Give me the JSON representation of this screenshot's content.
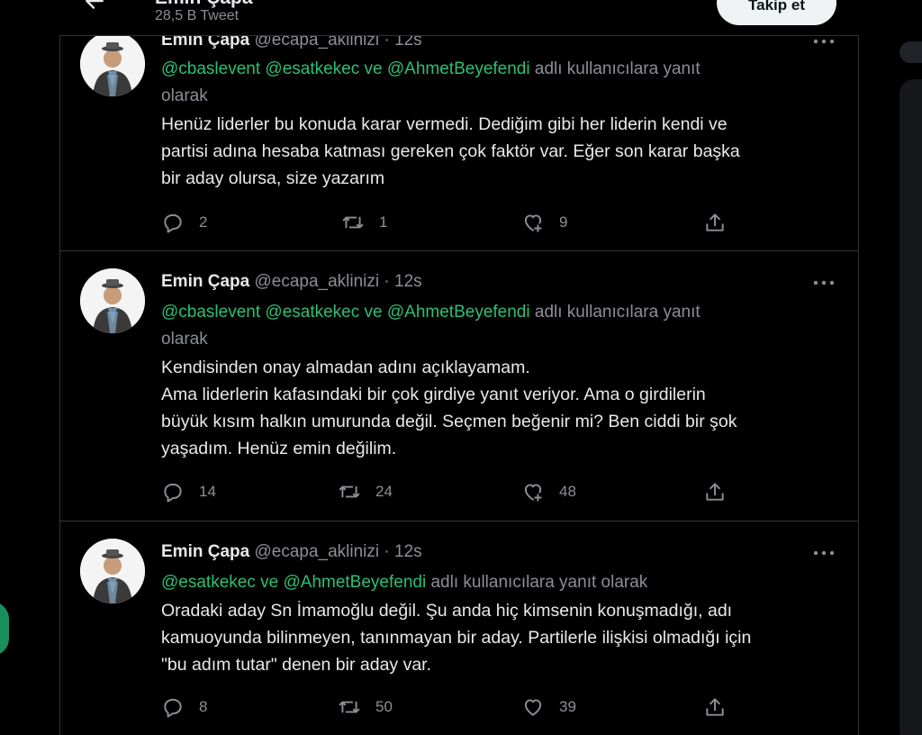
{
  "header": {
    "title": "Emin Çapa",
    "tweet_count": "28,5 B Tweet",
    "follow_label": "Takip et"
  },
  "tweets": [
    {
      "author": "Emin Çapa",
      "handle": "@ecapa_aklinizi",
      "dot": "·",
      "time": "12s",
      "reply_mentions": [
        "@cbaslevent",
        "@esatkekec",
        "@AhmetBeyefendi"
      ],
      "reply_and": "ve",
      "reply_suffix": "adlı kullanıcılara yanıt",
      "reply_suffix_2": "olarak",
      "lines": [
        "Henüz liderler bu konuda karar vermedi. Dediğim gibi her liderin kendi ve",
        "partisi adına hesaba katması gereken çok faktör var. Eğer son karar başka",
        "bir aday olursa, size yazarım"
      ],
      "replies": "2",
      "retweets": "1",
      "likes": "9"
    },
    {
      "author": "Emin Çapa",
      "handle": "@ecapa_aklinizi",
      "dot": "·",
      "time": "12s",
      "reply_mentions": [
        "@cbaslevent",
        "@esatkekec",
        "@AhmetBeyefendi"
      ],
      "reply_and": "ve",
      "reply_suffix": "adlı kullanıcılara yanıt",
      "reply_suffix_2": "olarak",
      "lines": [
        "Kendisinden onay almadan adını açıklayamam.",
        "Ama liderlerin kafasındaki bir çok girdiye yanıt veriyor. Ama o girdilerin",
        "büyük kısım halkın umurunda değil. Seçmen beğenir mi? Ben ciddi bir şok",
        "yaşadım. Henüz emin değilim."
      ],
      "replies": "14",
      "retweets": "24",
      "likes": "48"
    },
    {
      "author": "Emin Çapa",
      "handle": "@ecapa_aklinizi",
      "dot": "·",
      "time": "12s",
      "reply_mentions": [
        "@esatkekec",
        "@AhmetBeyefendi"
      ],
      "reply_and": "ve",
      "reply_suffix": "adlı kullanıcılara yanıt olarak",
      "lines": [
        "Oradaki aday Sn İmamoğlu değil. Şu anda hiç kimsenin konuşmadığı, adı",
        "kamuoyunda bilinmeyen, tanınmayan bir aday. Partilerle ilişkisi olmadığı için",
        "\"bu adım tutar\" denen bir aday var."
      ],
      "replies": "8",
      "retweets": "50",
      "likes": "39"
    }
  ],
  "icons": {
    "back": "arrow-left-icon",
    "more": "more-horizontal-icon",
    "reply": "reply-bubble-icon",
    "retweet": "retweet-icon",
    "like": "heart-icon",
    "share": "share-icon"
  },
  "colors": {
    "background": "#000000",
    "mention": "#2dbf75",
    "muted": "#8b8f94",
    "text": "#e7e9ea",
    "divider": "#2f3336"
  }
}
